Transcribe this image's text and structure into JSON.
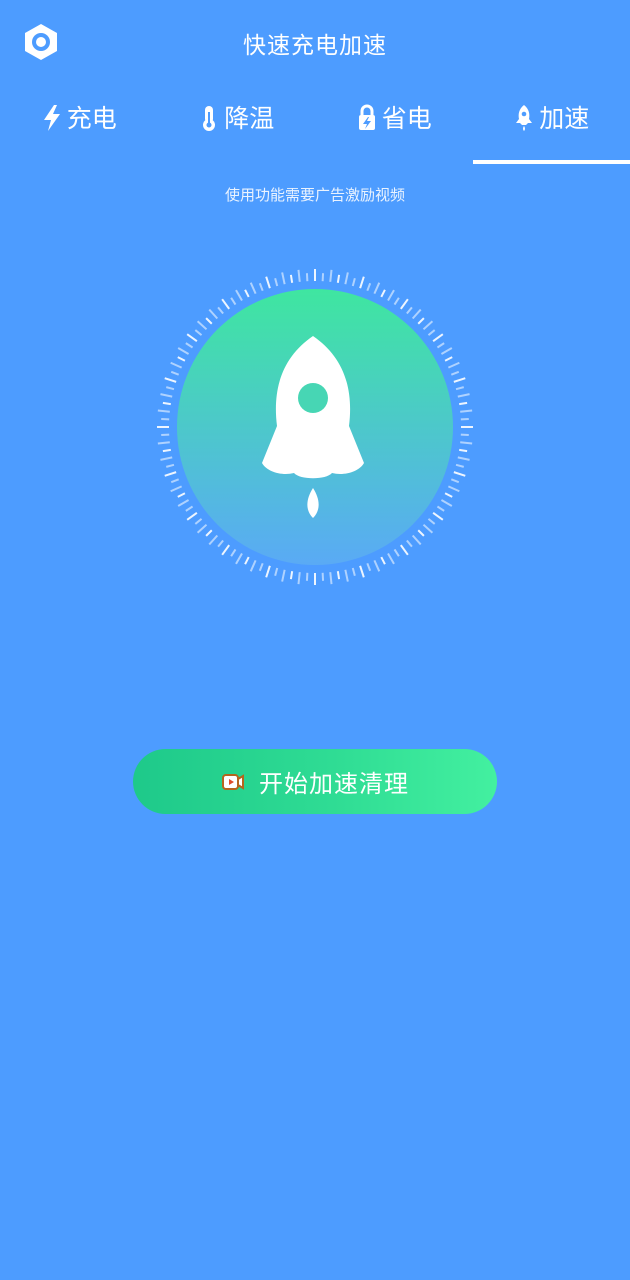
{
  "header": {
    "title": "快速充电加速",
    "settings_icon": "settings-hexagon-icon"
  },
  "tabs": [
    {
      "label": "充电",
      "icon": "lightning-icon",
      "active": false
    },
    {
      "label": "降温",
      "icon": "thermometer-icon",
      "active": false
    },
    {
      "label": "省电",
      "icon": "battery-lock-icon",
      "active": false
    },
    {
      "label": "加速",
      "icon": "rocket-icon",
      "active": true
    }
  ],
  "notice": "使用功能需要广告激励视频",
  "dial": {
    "center_icon": "rocket-icon",
    "colors": {
      "top": "#3fe6a0",
      "bottom": "#5aaaf5"
    }
  },
  "action": {
    "label": "开始加速清理",
    "icon": "video-icon"
  },
  "colors": {
    "background": "#4d9cff",
    "accent": "#2fdc94"
  }
}
